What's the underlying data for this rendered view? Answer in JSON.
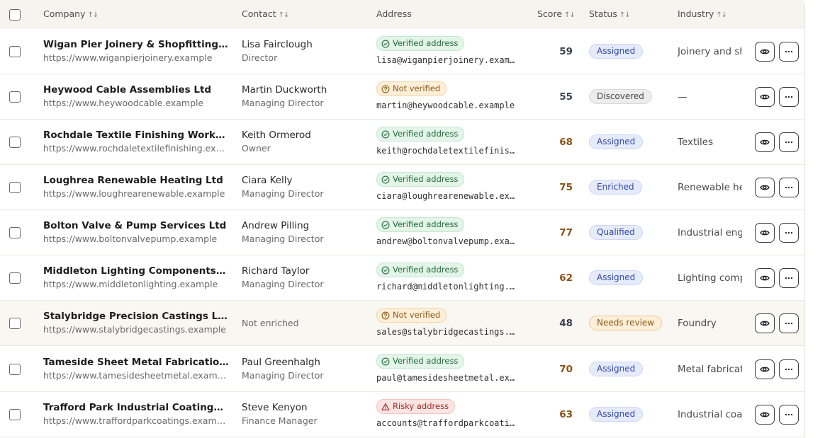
{
  "columns": {
    "company": "Company",
    "contact": "Contact",
    "address": "Address",
    "score": "Score",
    "status": "Status",
    "industry": "Industry"
  },
  "colors": {
    "score_neutral": "#3b4250",
    "score_warm": "#8a5214",
    "header_bg": "#f5f4ef",
    "highlight_row_bg": "#f8f7f2"
  },
  "rows": [
    {
      "company": "Wigan Pier Joinery & Shopfitting Ltd",
      "url": "https://www.wiganpierjoinery.example",
      "contact": "Lisa Fairclough",
      "role": "Director",
      "address_status": "Verified address",
      "address_kind": "verified",
      "email": "lisa@wiganpierjoinery.example",
      "score": "59",
      "score_tone": "neutral",
      "status": "Assigned",
      "status_kind": "assigned",
      "industry": "Joinery and shopfitting"
    },
    {
      "company": "Heywood Cable Assemblies Ltd",
      "url": "https://www.heywoodcable.example",
      "contact": "Martin Duckworth",
      "role": "Managing Director",
      "address_status": "Not verified",
      "address_kind": "notverified",
      "email": "martin@heywoodcable.example",
      "score": "55",
      "score_tone": "neutral",
      "status": "Discovered",
      "status_kind": "discovered",
      "industry": "—"
    },
    {
      "company": "Rochdale Textile Finishing Works Ltd",
      "url": "https://www.rochdaletextilefinishing.example",
      "contact": "Keith Ormerod",
      "role": "Owner",
      "address_status": "Verified address",
      "address_kind": "verified",
      "email": "keith@rochdaletextilefinishing.example",
      "score": "68",
      "score_tone": "warm",
      "status": "Assigned",
      "status_kind": "assigned",
      "industry": "Textiles"
    },
    {
      "company": "Loughrea Renewable Heating Ltd",
      "url": "https://www.loughrearenewable.example",
      "contact": "Ciara Kelly",
      "role": "Managing Director",
      "address_status": "Verified address",
      "address_kind": "verified",
      "email": "ciara@loughrearenewable.example",
      "score": "75",
      "score_tone": "warm",
      "status": "Enriched",
      "status_kind": "enriched",
      "industry": "Renewable heating"
    },
    {
      "company": "Bolton Valve & Pump Services Ltd",
      "url": "https://www.boltonvalvepump.example",
      "contact": "Andrew Pilling",
      "role": "Managing Director",
      "address_status": "Verified address",
      "address_kind": "verified",
      "email": "andrew@boltonvalvepump.example",
      "score": "77",
      "score_tone": "warm",
      "status": "Qualified",
      "status_kind": "qualified",
      "industry": "Industrial engineering"
    },
    {
      "company": "Middleton Lighting Components Ltd",
      "url": "https://www.middletonlighting.example",
      "contact": "Richard Taylor",
      "role": "Managing Director",
      "address_status": "Verified address",
      "address_kind": "verified",
      "email": "richard@middletonlighting.example",
      "score": "62",
      "score_tone": "warm",
      "status": "Assigned",
      "status_kind": "assigned",
      "industry": "Lighting components"
    },
    {
      "company": "Stalybridge Precision Castings Ltd",
      "url": "https://www.stalybridgecastings.example",
      "contact": "Not enriched",
      "role": "",
      "address_status": "Not verified",
      "address_kind": "notverified",
      "email": "sales@stalybridgecastings.example",
      "score": "48",
      "score_tone": "neutral",
      "status": "Needs review",
      "status_kind": "review",
      "industry": "Foundry",
      "highlight": true
    },
    {
      "company": "Tameside Sheet Metal Fabrications Ltd",
      "url": "https://www.tamesidesheetmetal.example",
      "contact": "Paul Greenhalgh",
      "role": "Managing Director",
      "address_status": "Verified address",
      "address_kind": "verified",
      "email": "paul@tamesidesheetmetal.example",
      "score": "70",
      "score_tone": "warm",
      "status": "Assigned",
      "status_kind": "assigned",
      "industry": "Metal fabrication"
    },
    {
      "company": "Trafford Park Industrial Coatings Ltd",
      "url": "https://www.traffordparkcoatings.example",
      "contact": "Steve Kenyon",
      "role": "Finance Manager",
      "address_status": "Risky address",
      "address_kind": "risky",
      "email": "accounts@traffordparkcoatings.example",
      "score": "63",
      "score_tone": "warm",
      "status": "Assigned",
      "status_kind": "assigned",
      "industry": "Industrial coatings"
    }
  ]
}
